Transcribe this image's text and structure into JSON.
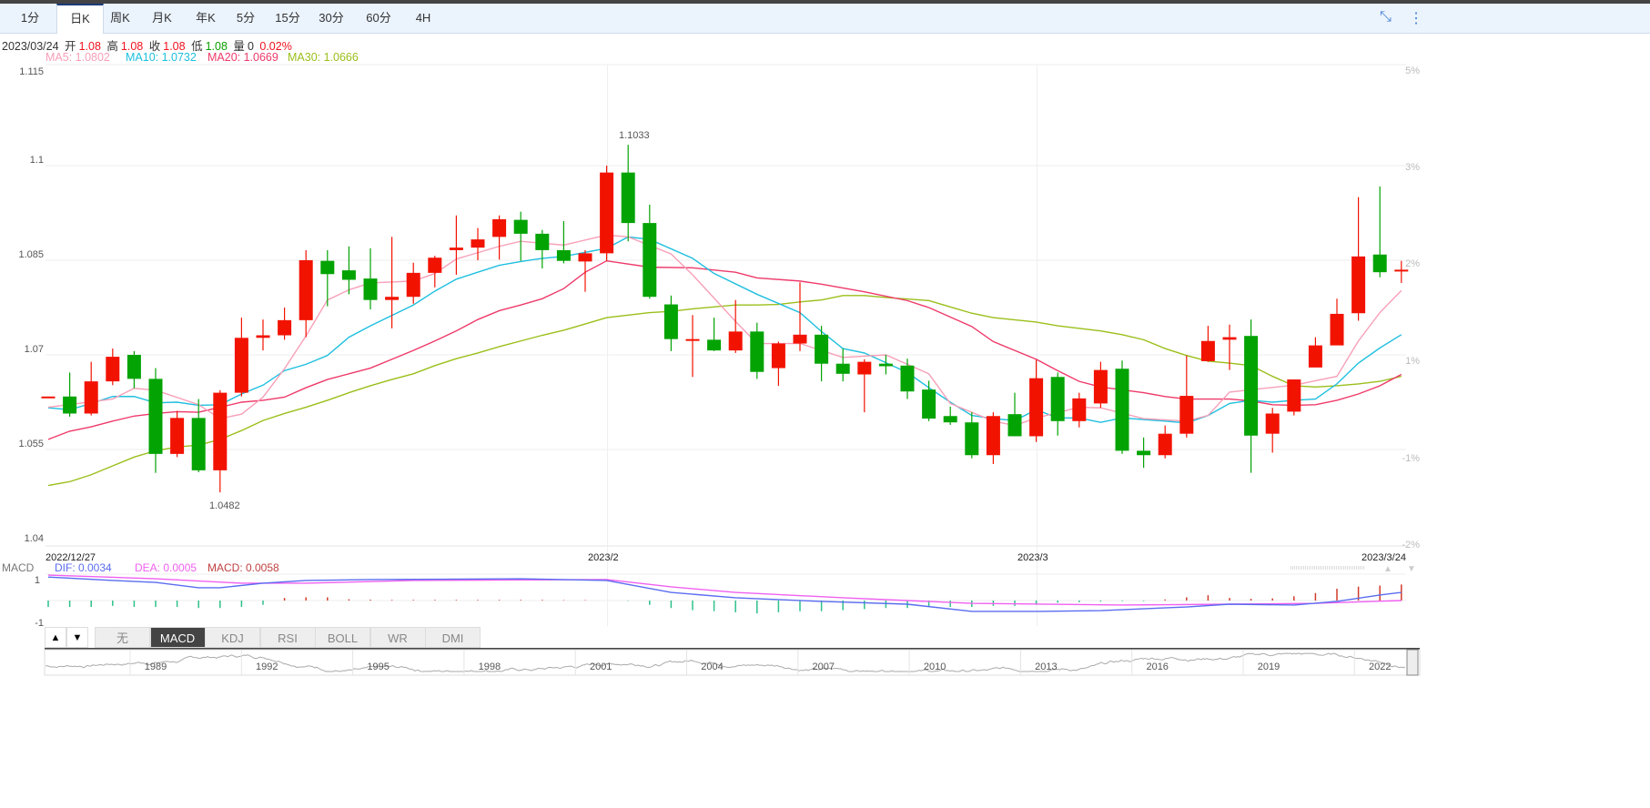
{
  "tabs": [
    "1分",
    "日K",
    "周K",
    "月K",
    "年K",
    "5分",
    "15分",
    "30分",
    "60分",
    "4H"
  ],
  "active_tab": "日K",
  "toolbar": {
    "collapse_icon": "collapse-icon",
    "more_icon": "more-vertical-icon"
  },
  "info": {
    "date": "2023/03/24",
    "open_label": "开",
    "open": "1.08",
    "high_label": "高",
    "high": "1.08",
    "close_label": "收",
    "close": "1.08",
    "low_label": "低",
    "low": "1.08",
    "vol_label": "量",
    "vol": "0",
    "change": "0.02%"
  },
  "ma_legend": {
    "ma5": "MA5: 1.0802",
    "ma10": "MA10: 1.0732",
    "ma20": "MA20: 1.0669",
    "ma30": "MA30: 1.0666"
  },
  "colors": {
    "up": "#f21200",
    "down": "#03a303",
    "ma5": "#f7a0b8",
    "ma10": "#1ebfdf",
    "ma20": "#ee3a6a",
    "ma30": "#9abf1a",
    "dif": "#5a6df0",
    "dea": "#f060f0",
    "macd": "#c04040"
  },
  "y_axis": {
    "labels": [
      "1.115",
      "1.1",
      "1.085",
      "1.07",
      "1.055",
      "1.04"
    ],
    "values": [
      1.115,
      1.1,
      1.085,
      1.07,
      1.055,
      1.04
    ]
  },
  "pct_axis": {
    "labels": [
      "5%",
      "3%",
      "2%",
      "1%",
      "-1%",
      "-2%"
    ]
  },
  "x_axis": {
    "start": "2022/12/27",
    "mid1": "2023/2",
    "mid2": "2023/3",
    "end": "2023/3/24"
  },
  "annotations": {
    "high": "1.1033",
    "low": "1.0482"
  },
  "macd_legend": {
    "name": "MACD",
    "dif": "DIF: 0.0034",
    "dea": "DEA: 0.0005",
    "macd": "MACD: 0.0058",
    "axis_top": "1",
    "axis_bottom": "-1"
  },
  "indicator_tabs": [
    "无",
    "MACD",
    "KDJ",
    "RSI",
    "BOLL",
    "WR",
    "DMI"
  ],
  "active_indicator": "MACD",
  "navigator_years": [
    "1989",
    "1992",
    "1995",
    "1998",
    "2001",
    "2004",
    "2007",
    "2010",
    "2013",
    "2016",
    "2019",
    "2022"
  ],
  "chart_data": {
    "type": "candlestick",
    "ylim": [
      1.04,
      1.115
    ],
    "ohlc": [
      [
        1.0634,
        1.0634,
        1.0634,
        1.0634
      ],
      [
        1.0634,
        1.0672,
        1.0602,
        1.0607
      ],
      [
        1.0607,
        1.0689,
        1.0604,
        1.0658
      ],
      [
        1.0658,
        1.071,
        1.0652,
        1.0697
      ],
      [
        1.07,
        1.0706,
        1.0647,
        1.0662
      ],
      [
        1.0662,
        1.0679,
        1.0513,
        1.0543
      ],
      [
        1.0543,
        1.0611,
        1.0538,
        1.06
      ],
      [
        1.06,
        1.063,
        1.0514,
        1.0517
      ],
      [
        1.0517,
        1.0644,
        1.0482,
        1.064
      ],
      [
        1.064,
        1.0759,
        1.0634,
        1.0727
      ],
      [
        1.0727,
        1.0756,
        1.0707,
        1.0731
      ],
      [
        1.0731,
        1.0775,
        1.0724,
        1.0755
      ],
      [
        1.0755,
        1.0866,
        1.0728,
        1.085
      ],
      [
        1.0849,
        1.0866,
        1.0777,
        1.0828
      ],
      [
        1.0834,
        1.0872,
        1.0796,
        1.0819
      ],
      [
        1.0821,
        1.0869,
        1.0772,
        1.0787
      ],
      [
        1.0787,
        1.0887,
        1.0742,
        1.0792
      ],
      [
        1.0792,
        1.0846,
        1.0781,
        1.083
      ],
      [
        1.083,
        1.0857,
        1.0807,
        1.0854
      ],
      [
        1.0866,
        1.0921,
        1.0827,
        1.087
      ],
      [
        1.087,
        1.0901,
        1.085,
        1.0883
      ],
      [
        1.0887,
        1.0921,
        1.0851,
        1.0915
      ],
      [
        1.0914,
        1.0927,
        1.0849,
        1.0892
      ],
      [
        1.0892,
        1.0898,
        1.0837,
        1.0866
      ],
      [
        1.0866,
        1.0912,
        1.0845,
        1.0849
      ],
      [
        1.0848,
        1.0866,
        1.08,
        1.0861
      ],
      [
        1.0861,
        1.1,
        1.0849,
        1.0989
      ],
      [
        1.0989,
        1.1033,
        1.088,
        1.0909
      ],
      [
        1.0909,
        1.0938,
        1.0789,
        1.0792
      ],
      [
        1.078,
        1.0794,
        1.0706,
        1.0725
      ],
      [
        1.0724,
        1.0763,
        1.0665,
        1.0725
      ],
      [
        1.0724,
        1.0759,
        1.0706,
        1.0707
      ],
      [
        1.0707,
        1.0787,
        1.0703,
        1.0737
      ],
      [
        1.0737,
        1.0751,
        1.0662,
        1.0673
      ],
      [
        1.0679,
        1.0721,
        1.0651,
        1.0718
      ],
      [
        1.0718,
        1.0815,
        1.0706,
        1.0732
      ],
      [
        1.0732,
        1.0746,
        1.0658,
        1.0686
      ],
      [
        1.0686,
        1.071,
        1.0658,
        1.067
      ],
      [
        1.0669,
        1.0693,
        1.0609,
        1.0689
      ],
      [
        1.0686,
        1.07,
        1.0669,
        1.0682
      ],
      [
        1.0683,
        1.0694,
        1.063,
        1.0642
      ],
      [
        1.0645,
        1.0659,
        1.0595,
        1.0599
      ],
      [
        1.0603,
        1.0618,
        1.0589,
        1.0593
      ],
      [
        1.0593,
        1.0609,
        1.0536,
        1.0541
      ],
      [
        1.0541,
        1.0609,
        1.0527,
        1.0603
      ],
      [
        1.0606,
        1.064,
        1.0571,
        1.0571
      ],
      [
        1.0571,
        1.0692,
        1.0562,
        1.0663
      ],
      [
        1.0665,
        1.0672,
        1.0572,
        1.0595
      ],
      [
        1.0595,
        1.064,
        1.0585,
        1.0631
      ],
      [
        1.0623,
        1.0689,
        1.0616,
        1.0676
      ],
      [
        1.0678,
        1.0691,
        1.0543,
        1.0548
      ],
      [
        1.0548,
        1.0569,
        1.0521,
        1.0541
      ],
      [
        1.0541,
        1.0588,
        1.0536,
        1.0575
      ],
      [
        1.0575,
        1.0699,
        1.0569,
        1.0635
      ],
      [
        1.069,
        1.0746,
        1.0689,
        1.0722
      ],
      [
        1.0724,
        1.0748,
        1.0676,
        1.0728
      ],
      [
        1.073,
        1.0756,
        1.0513,
        1.0572
      ],
      [
        1.0575,
        1.0616,
        1.0545,
        1.0607
      ],
      [
        1.061,
        1.0661,
        1.0604,
        1.0661
      ],
      [
        1.068,
        1.0728,
        1.0701,
        1.0715
      ],
      [
        1.0715,
        1.0789,
        1.0758,
        1.0765
      ],
      [
        1.0766,
        1.095,
        1.0754,
        1.0856
      ],
      [
        1.0859,
        1.0967,
        1.0823,
        1.0831
      ],
      [
        1.0834,
        1.0849,
        1.0814,
        1.0835
      ]
    ],
    "ma5": [
      [
        0,
        1.0617
      ],
      [
        3,
        1.063
      ],
      [
        4,
        1.0647
      ],
      [
        5,
        1.0644
      ],
      [
        7,
        1.0621
      ],
      [
        8,
        1.0599
      ],
      [
        9,
        1.0606
      ],
      [
        10,
        1.0633
      ],
      [
        11,
        1.0678
      ],
      [
        12,
        1.073
      ],
      [
        13,
        1.0787
      ],
      [
        14,
        1.0803
      ],
      [
        15,
        1.0814
      ],
      [
        17,
        1.0817
      ],
      [
        18,
        1.0829
      ],
      [
        19,
        1.0852
      ],
      [
        21,
        1.0872
      ],
      [
        22,
        1.088
      ],
      [
        24,
        1.0874
      ],
      [
        26,
        1.089
      ],
      [
        27,
        1.0887
      ],
      [
        29,
        1.086
      ],
      [
        30,
        1.0827
      ],
      [
        32,
        1.0753
      ],
      [
        33,
        1.0718
      ],
      [
        35,
        1.0718
      ],
      [
        37,
        1.0696
      ],
      [
        39,
        1.07
      ],
      [
        41,
        1.067
      ],
      [
        42,
        1.0623
      ],
      [
        44,
        1.0595
      ],
      [
        45,
        1.0588
      ],
      [
        46,
        1.06
      ],
      [
        48,
        1.0617
      ],
      [
        49,
        1.0616
      ],
      [
        51,
        1.0599
      ],
      [
        53,
        1.0595
      ],
      [
        54,
        1.0604
      ],
      [
        55,
        1.0641
      ],
      [
        58,
        1.0652
      ],
      [
        60,
        1.0666
      ],
      [
        61,
        1.0722
      ],
      [
        62,
        1.0767
      ],
      [
        63,
        1.0802
      ]
    ],
    "ma10": [
      [
        0,
        1.0616
      ],
      [
        1,
        1.0613
      ],
      [
        2,
        1.0623
      ],
      [
        3,
        1.0634
      ],
      [
        4,
        1.0634
      ],
      [
        5,
        1.0624
      ],
      [
        6,
        1.0625
      ],
      [
        7,
        1.062
      ],
      [
        8,
        1.0621
      ],
      [
        9,
        1.0638
      ],
      [
        10,
        1.0652
      ],
      [
        11,
        1.0675
      ],
      [
        12,
        1.0685
      ],
      [
        13,
        1.0699
      ],
      [
        14,
        1.0728
      ],
      [
        15,
        1.0746
      ],
      [
        17,
        1.0779
      ],
      [
        18,
        1.0801
      ],
      [
        19,
        1.082
      ],
      [
        21,
        1.0842
      ],
      [
        22,
        1.0848
      ],
      [
        23,
        1.0853
      ],
      [
        24,
        1.0856
      ],
      [
        26,
        1.0869
      ],
      [
        27,
        1.0887
      ],
      [
        28,
        1.0883
      ],
      [
        30,
        1.0853
      ],
      [
        31,
        1.0829
      ],
      [
        33,
        1.0796
      ],
      [
        35,
        1.0767
      ],
      [
        36,
        1.0737
      ],
      [
        37,
        1.071
      ],
      [
        38,
        1.0703
      ],
      [
        40,
        1.0672
      ],
      [
        41,
        1.0648
      ],
      [
        42,
        1.0625
      ],
      [
        43,
        1.0604
      ],
      [
        44,
        1.0599
      ],
      [
        45,
        1.0596
      ],
      [
        46,
        1.0613
      ],
      [
        47,
        1.06
      ],
      [
        48,
        1.06
      ],
      [
        49,
        1.0593
      ],
      [
        50,
        1.06
      ],
      [
        52,
        1.0595
      ],
      [
        53,
        1.0592
      ],
      [
        54,
        1.0604
      ],
      [
        55,
        1.0623
      ],
      [
        56,
        1.0628
      ],
      [
        57,
        1.0625
      ],
      [
        58,
        1.0628
      ],
      [
        59,
        1.063
      ],
      [
        60,
        1.0654
      ],
      [
        61,
        1.0687
      ],
      [
        62,
        1.0711
      ],
      [
        63,
        1.0732
      ]
    ],
    "ma20": [
      [
        0,
        1.0566
      ],
      [
        1,
        1.0579
      ],
      [
        2,
        1.0586
      ],
      [
        3,
        1.0595
      ],
      [
        4,
        1.0603
      ],
      [
        5,
        1.0607
      ],
      [
        6,
        1.061
      ],
      [
        7,
        1.0609
      ],
      [
        8,
        1.0617
      ],
      [
        9,
        1.0625
      ],
      [
        10,
        1.0628
      ],
      [
        11,
        1.0633
      ],
      [
        12,
        1.0648
      ],
      [
        13,
        1.0661
      ],
      [
        14,
        1.067
      ],
      [
        15,
        1.0679
      ],
      [
        16,
        1.0693
      ],
      [
        17,
        1.0707
      ],
      [
        18,
        1.0722
      ],
      [
        19,
        1.0738
      ],
      [
        20,
        1.0756
      ],
      [
        21,
        1.077
      ],
      [
        22,
        1.0779
      ],
      [
        23,
        1.0789
      ],
      [
        24,
        1.0805
      ],
      [
        25,
        1.0831
      ],
      [
        26,
        1.0849
      ],
      [
        28,
        1.0839
      ],
      [
        30,
        1.0838
      ],
      [
        32,
        1.0831
      ],
      [
        33,
        1.0822
      ],
      [
        35,
        1.0817
      ],
      [
        36,
        1.0812
      ],
      [
        38,
        1.08
      ],
      [
        40,
        1.0786
      ],
      [
        41,
        1.0775
      ],
      [
        43,
        1.0745
      ],
      [
        44,
        1.0721
      ],
      [
        46,
        1.0693
      ],
      [
        47,
        1.0675
      ],
      [
        48,
        1.0658
      ],
      [
        49,
        1.0649
      ],
      [
        51,
        1.064
      ],
      [
        52,
        1.0634
      ],
      [
        53,
        1.063
      ],
      [
        55,
        1.063
      ],
      [
        56,
        1.0627
      ],
      [
        57,
        1.0621
      ],
      [
        58,
        1.062
      ],
      [
        59,
        1.0621
      ],
      [
        60,
        1.0628
      ],
      [
        61,
        1.0638
      ],
      [
        62,
        1.0651
      ],
      [
        63,
        1.0669
      ]
    ],
    "ma30": [
      [
        0,
        1.0493
      ],
      [
        1,
        1.0499
      ],
      [
        2,
        1.051
      ],
      [
        3,
        1.0524
      ],
      [
        4,
        1.0538
      ],
      [
        5,
        1.0548
      ],
      [
        6,
        1.0554
      ],
      [
        7,
        1.0557
      ],
      [
        8,
        1.0566
      ],
      [
        9,
        1.058
      ],
      [
        10,
        1.0596
      ],
      [
        11,
        1.0607
      ],
      [
        12,
        1.0617
      ],
      [
        13,
        1.0628
      ],
      [
        14,
        1.064
      ],
      [
        15,
        1.0651
      ],
      [
        16,
        1.0661
      ],
      [
        17,
        1.067
      ],
      [
        18,
        1.0683
      ],
      [
        19,
        1.0694
      ],
      [
        20,
        1.0703
      ],
      [
        21,
        1.0713
      ],
      [
        22,
        1.0722
      ],
      [
        23,
        1.0731
      ],
      [
        24,
        1.0739
      ],
      [
        25,
        1.0749
      ],
      [
        26,
        1.0759
      ],
      [
        27,
        1.0763
      ],
      [
        28,
        1.0767
      ],
      [
        29,
        1.0769
      ],
      [
        30,
        1.0773
      ],
      [
        31,
        1.0776
      ],
      [
        32,
        1.0779
      ],
      [
        33,
        1.0779
      ],
      [
        34,
        1.078
      ],
      [
        35,
        1.0784
      ],
      [
        36,
        1.0787
      ],
      [
        37,
        1.0794
      ],
      [
        38,
        1.0794
      ],
      [
        39,
        1.0791
      ],
      [
        41,
        1.0786
      ],
      [
        42,
        1.0776
      ],
      [
        43,
        1.0766
      ],
      [
        44,
        1.0759
      ],
      [
        46,
        1.0752
      ],
      [
        47,
        1.0746
      ],
      [
        49,
        1.0738
      ],
      [
        50,
        1.0732
      ],
      [
        51,
        1.0724
      ],
      [
        52,
        1.071
      ],
      [
        53,
        1.0699
      ],
      [
        54,
        1.069
      ],
      [
        55,
        1.0687
      ],
      [
        56,
        1.0683
      ],
      [
        57,
        1.0666
      ],
      [
        58,
        1.0651
      ],
      [
        59,
        1.0649
      ],
      [
        60,
        1.0651
      ],
      [
        61,
        1.0654
      ],
      [
        62,
        1.0658
      ],
      [
        63,
        1.0666
      ]
    ],
    "macd_panel": {
      "ylim": [
        -1,
        1
      ],
      "dif": [
        [
          0,
          1.1
        ],
        [
          3,
          0.94
        ],
        [
          5,
          0.85
        ],
        [
          7,
          0.6
        ],
        [
          8,
          0.6
        ],
        [
          10,
          0.81
        ],
        [
          12,
          0.94
        ],
        [
          15,
          0.98
        ],
        [
          22,
          1.02
        ],
        [
          26,
          0.94
        ],
        [
          29,
          0.38
        ],
        [
          32,
          0.13
        ],
        [
          36,
          -0.04
        ],
        [
          40,
          -0.17
        ],
        [
          43,
          -0.51
        ],
        [
          46,
          -0.51
        ],
        [
          49,
          -0.47
        ],
        [
          53,
          -0.3
        ],
        [
          55,
          -0.17
        ],
        [
          58,
          -0.21
        ],
        [
          60,
          -0.04
        ],
        [
          62,
          0.26
        ],
        [
          63,
          0.38
        ]
      ],
      "dea": [
        [
          0,
          1.19
        ],
        [
          5,
          1.02
        ],
        [
          9,
          0.81
        ],
        [
          12,
          0.81
        ],
        [
          17,
          0.94
        ],
        [
          26,
          0.98
        ],
        [
          29,
          0.64
        ],
        [
          32,
          0.38
        ],
        [
          37,
          0.13
        ],
        [
          43,
          -0.13
        ],
        [
          50,
          -0.21
        ],
        [
          55,
          -0.17
        ],
        [
          59,
          -0.13
        ],
        [
          63,
          0.0
        ]
      ],
      "hist": [
        -0.3,
        -0.3,
        -0.3,
        -0.25,
        -0.3,
        -0.3,
        -0.3,
        -0.35,
        -0.35,
        -0.3,
        -0.2,
        0.12,
        0.15,
        0.15,
        0.06,
        0.04,
        0.03,
        0.03,
        0.03,
        0.03,
        0.03,
        0.03,
        0.03,
        0.03,
        0.02,
        0.02,
        0,
        -0.02,
        -0.2,
        -0.35,
        -0.45,
        -0.5,
        -0.55,
        -0.6,
        -0.55,
        -0.5,
        -0.5,
        -0.45,
        -0.4,
        -0.35,
        -0.35,
        -0.3,
        -0.3,
        -0.3,
        -0.25,
        -0.25,
        -0.2,
        -0.1,
        -0.08,
        -0.05,
        -0.03,
        -0.03,
        0.05,
        0.15,
        0.25,
        0.12,
        0.08,
        0.1,
        0.2,
        0.35,
        0.55,
        0.65,
        0.7,
        0.75
      ]
    }
  }
}
